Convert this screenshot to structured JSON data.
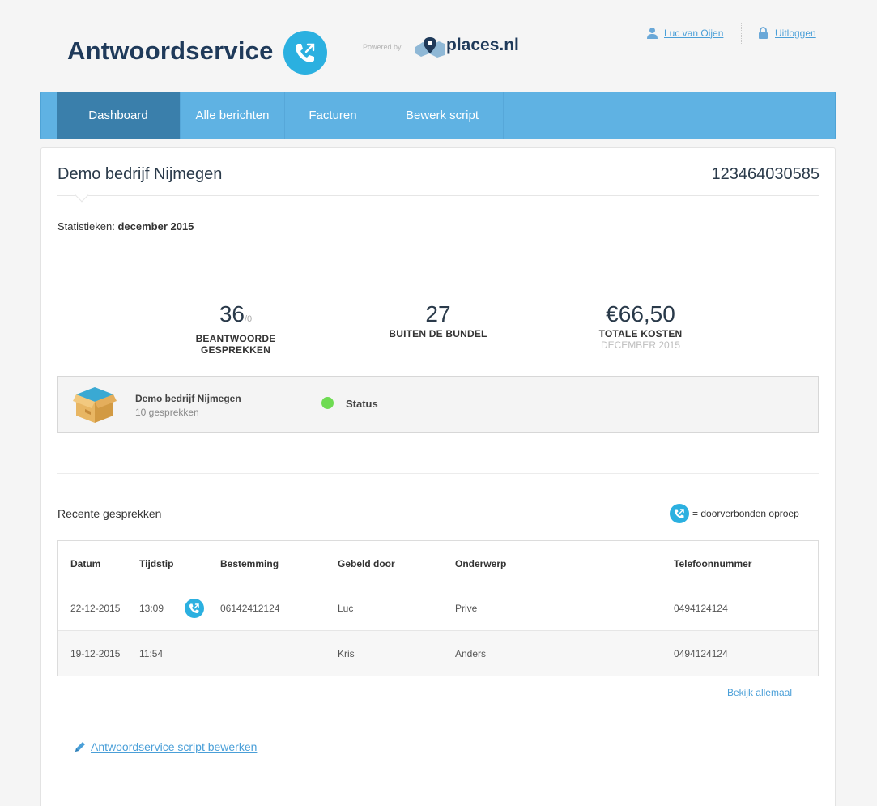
{
  "header": {
    "brand": "Antwoordservice",
    "powered_by": "Powered by",
    "partner": "places.nl",
    "user_name": "Luc van Oijen",
    "logout": "Uitloggen"
  },
  "nav": {
    "tabs": [
      {
        "label": "Dashboard",
        "active": true
      },
      {
        "label": "Alle berichten",
        "active": false
      },
      {
        "label": "Facturen",
        "active": false
      },
      {
        "label": "Bewerk script",
        "active": false
      }
    ]
  },
  "company": {
    "name": "Demo bedrijf Nijmegen",
    "number": "123464030585"
  },
  "stats": {
    "label": "Statistieken:",
    "period": "december 2015",
    "items": [
      {
        "value": "36",
        "suffix": "/0",
        "label1": "BEANTWOORDE",
        "label2": "GESPREKKEN"
      },
      {
        "value": "27",
        "label1": "BUITEN DE BUNDEL"
      },
      {
        "value": "€66,50",
        "label1": "TOTALE KOSTEN",
        "sub": "DECEMBER 2015"
      }
    ]
  },
  "bundle": {
    "name": "Demo bedrijf Nijmegen",
    "count": "10 gesprekken",
    "status_label": "Status",
    "status_color": "#6edb52"
  },
  "recent": {
    "title": "Recente gesprekken",
    "legend": "= doorverbonden oproep",
    "columns": [
      "Datum",
      "Tijdstip",
      "Bestemming",
      "Gebeld door",
      "Onderwerp",
      "Telefoonnummer"
    ],
    "rows": [
      {
        "datum": "22-12-2015",
        "tijdstip": "13:09",
        "forwarded": true,
        "bestemming": "06142412124",
        "gebeld_door": "Luc",
        "onderwerp": "Prive",
        "telefoon": "0494124124"
      },
      {
        "datum": "19-12-2015",
        "tijdstip": "11:54",
        "forwarded": false,
        "bestemming": "",
        "gebeld_door": "Kris",
        "onderwerp": "Anders",
        "telefoon": "0494124124"
      }
    ],
    "view_all": "Bekijk allemaal"
  },
  "footer": {
    "edit_script": "Antwoordservice script bewerken"
  },
  "colors": {
    "nav": "#5fb2e3",
    "nav_active": "#3a7fab",
    "accent": "#2bb0e0",
    "link": "#4a9fd8"
  },
  "icons": [
    "phone-forward-icon",
    "map-pin-logo-icon",
    "user-icon",
    "lock-icon",
    "box-icon",
    "pencil-icon"
  ]
}
